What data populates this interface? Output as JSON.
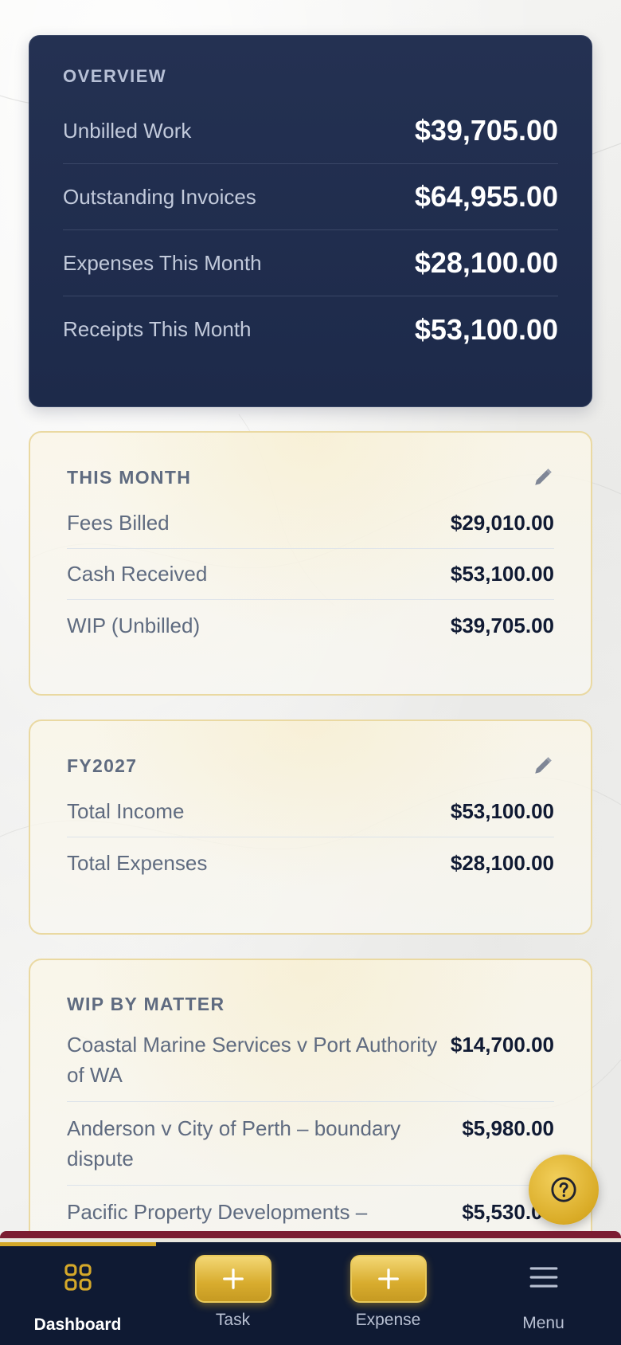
{
  "overview": {
    "title": "OVERVIEW",
    "rows": [
      {
        "label": "Unbilled Work",
        "value": "$39,705.00"
      },
      {
        "label": "Outstanding Invoices",
        "value": "$64,955.00"
      },
      {
        "label": "Expenses This Month",
        "value": "$28,100.00"
      },
      {
        "label": "Receipts This Month",
        "value": "$53,100.00"
      }
    ]
  },
  "this_month": {
    "title": "THIS MONTH",
    "rows": [
      {
        "label": "Fees Billed",
        "value": "$29,010.00"
      },
      {
        "label": "Cash Received",
        "value": "$53,100.00"
      },
      {
        "label": "WIP (Unbilled)",
        "value": "$39,705.00"
      }
    ]
  },
  "fy": {
    "title": "FY2027",
    "rows": [
      {
        "label": "Total Income",
        "value": "$53,100.00"
      },
      {
        "label": "Total Expenses",
        "value": "$28,100.00"
      }
    ]
  },
  "wip_by_matter": {
    "title": "WIP BY MATTER",
    "rows": [
      {
        "label": "Coastal Marine Services v Port Authority of WA",
        "value": "$14,700.00"
      },
      {
        "label": "Anderson v City of Perth – boundary dispute",
        "value": "$5,980.00"
      },
      {
        "label": "Pacific Property Developments –",
        "value": "$5,530.00"
      }
    ]
  },
  "nav": {
    "items": [
      {
        "label": "Dashboard",
        "icon": "dashboard-grid-icon",
        "active": true
      },
      {
        "label": "Task",
        "icon": "plus-icon"
      },
      {
        "label": "Expense",
        "icon": "plus-icon"
      },
      {
        "label": "Menu",
        "icon": "hamburger-menu-icon"
      }
    ]
  },
  "help_icon": "question-circle-icon",
  "edit_icon": "pencil-icon",
  "colors": {
    "navy": "#1f2c4e",
    "gold": "#d4a82a",
    "nav_bg": "#0f1a33",
    "accent_line": "#7b1d32"
  }
}
